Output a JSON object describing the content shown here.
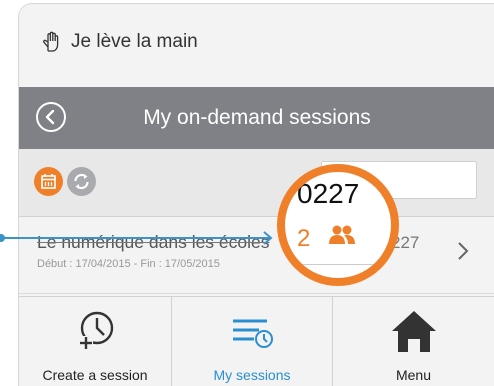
{
  "app": {
    "name": "Je lève la main"
  },
  "navbar": {
    "title": "My on-demand sessions"
  },
  "session": {
    "title": "Le numérique dans les écoles",
    "dates": "Début : 17/04/2015 - Fin : 17/05/2015",
    "code": "227"
  },
  "magnifier": {
    "code": "0227",
    "participants": "2"
  },
  "tabs": [
    {
      "label": "Create a session"
    },
    {
      "label": "My sessions"
    },
    {
      "label": "Menu"
    }
  ],
  "colors": {
    "accent": "#f07f2a",
    "active_tab": "#2a8fd0",
    "navbar": "#7f8186",
    "connector": "#3b93c9"
  },
  "icons": [
    "raised-hand-icon",
    "back-icon",
    "calendar-icon",
    "refresh-icon",
    "search-icon",
    "chevron-right-icon",
    "clock-plus-icon",
    "list-clock-icon",
    "home-icon",
    "people-icon"
  ]
}
